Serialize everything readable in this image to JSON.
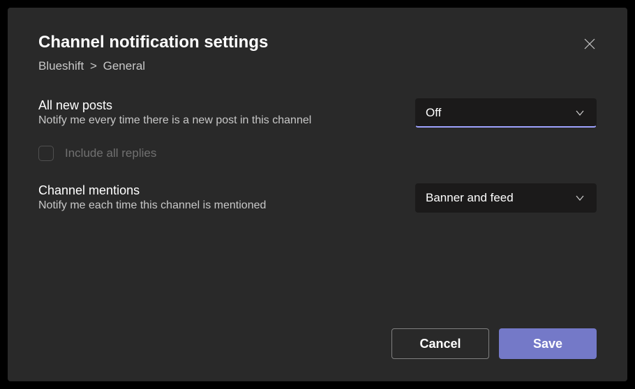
{
  "title": "Channel notification settings",
  "breadcrumb": {
    "team": "Blueshift",
    "channel": "General",
    "separator": ">"
  },
  "settings": {
    "allNewPosts": {
      "label": "All new posts",
      "description": "Notify me every time there is a new post in this channel",
      "value": "Off"
    },
    "includeReplies": {
      "label": "Include all replies"
    },
    "channelMentions": {
      "label": "Channel mentions",
      "description": "Notify me each time this channel is mentioned",
      "value": "Banner and feed"
    }
  },
  "buttons": {
    "cancel": "Cancel",
    "save": "Save"
  }
}
